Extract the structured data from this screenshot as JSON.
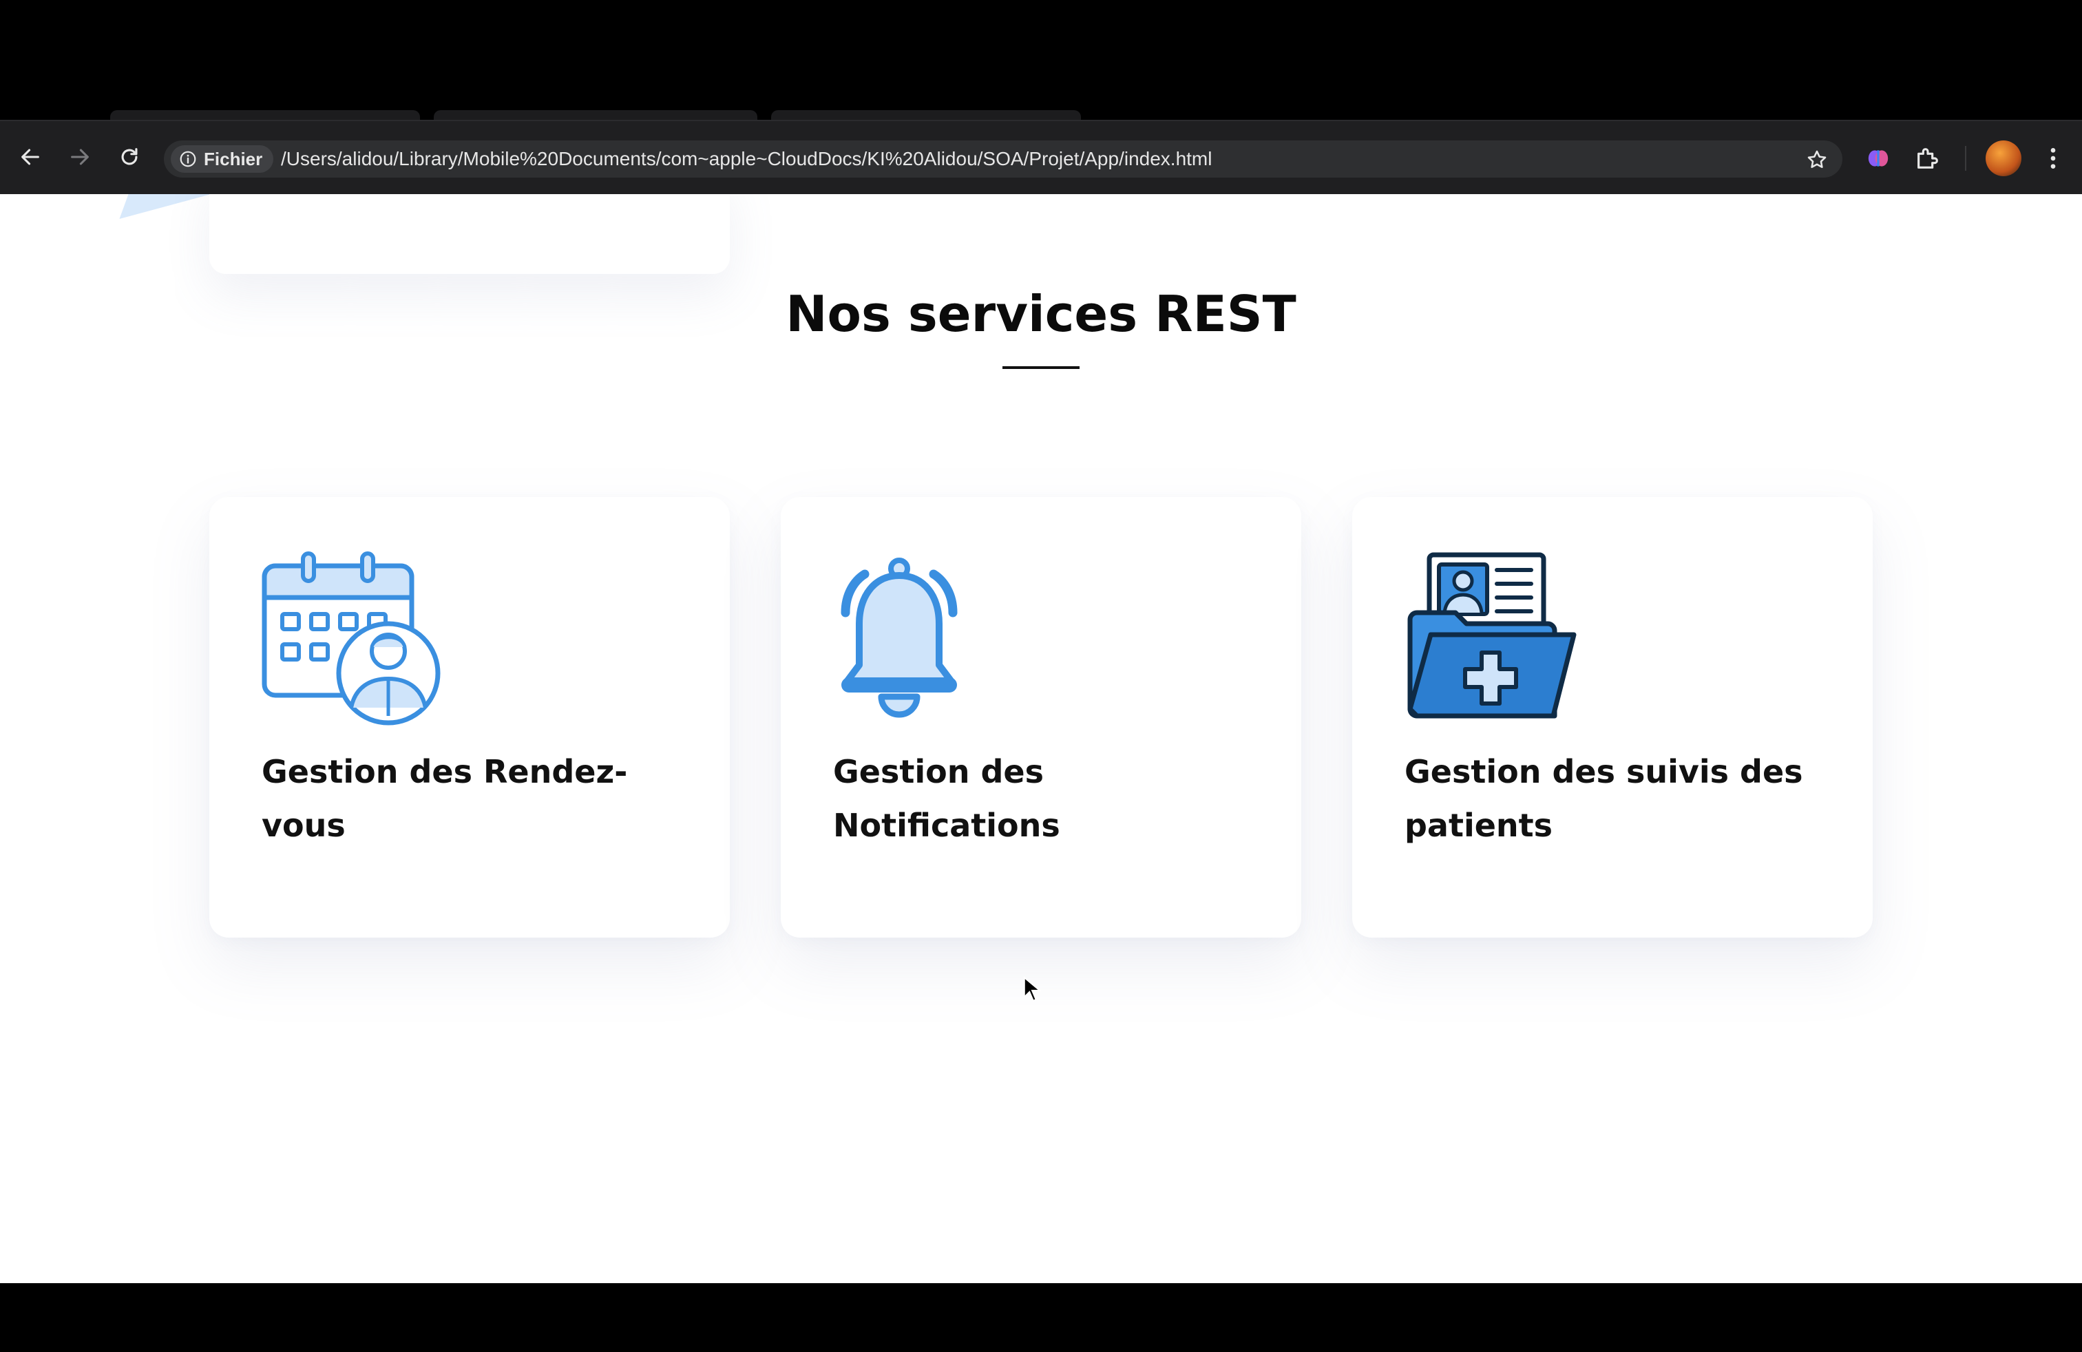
{
  "browser": {
    "back_label": "Back",
    "forward_label": "Forward",
    "reload_label": "Reload",
    "site_chip_label": "Fichier",
    "url": "/Users/alidou/Library/Mobile%20Documents/com~apple~CloudDocs/KI%20Alidou/SOA/Projet/App/index.html",
    "icons": [
      "back-arrow-icon",
      "forward-arrow-icon",
      "reload-icon",
      "info-icon",
      "star-icon",
      "extension-brain-icon",
      "puzzle-icon",
      "avatar",
      "kebab-menu-icon"
    ]
  },
  "page": {
    "section_title": "Nos services REST",
    "services": [
      {
        "title": "Gestion des Rendez-vous",
        "icon": "calendar-user-icon"
      },
      {
        "title": "Gestion des Notifications",
        "icon": "bell-icon"
      },
      {
        "title": "Gestion des suivis des patients",
        "icon": "medical-folder-icon"
      }
    ]
  },
  "colors": {
    "accent_blue": "#3a8fe0",
    "light_blue": "#cfe4fa",
    "dark_navy": "#0f2b46",
    "title_text": "#0b0b0b"
  }
}
